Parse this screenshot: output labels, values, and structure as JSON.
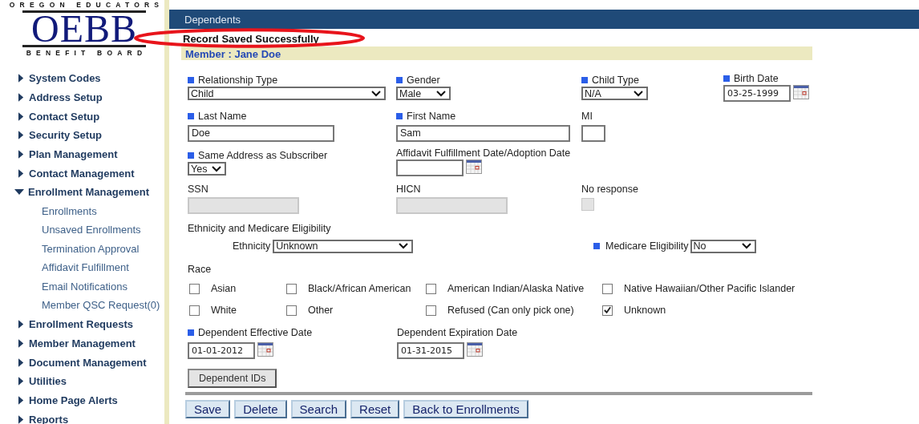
{
  "logo": {
    "top_line": "OREGON EDUCATORS",
    "name": "OEBB",
    "bottom_line": "BENEFIT BOARD"
  },
  "sidebar": {
    "items": [
      {
        "label": "System Codes",
        "expanded": false
      },
      {
        "label": "Address Setup",
        "expanded": false
      },
      {
        "label": "Contact Setup",
        "expanded": false
      },
      {
        "label": "Security Setup",
        "expanded": false
      },
      {
        "label": "Plan Management",
        "expanded": false
      },
      {
        "label": "Contact Management",
        "expanded": false
      },
      {
        "label": "Enrollment Management",
        "expanded": true,
        "children": [
          {
            "label": "Enrollments"
          },
          {
            "label": "Unsaved Enrollments"
          },
          {
            "label": "Termination Approval"
          },
          {
            "label": "Affidavit Fulfillment"
          },
          {
            "label": "Email Notifications"
          },
          {
            "label": "Member QSC Request(0)"
          }
        ]
      },
      {
        "label": "Enrollment Requests",
        "expanded": false
      },
      {
        "label": "Member Management",
        "expanded": false
      },
      {
        "label": "Document Management",
        "expanded": false
      },
      {
        "label": "Utilities",
        "expanded": false
      },
      {
        "label": "Home Page Alerts",
        "expanded": false
      },
      {
        "label": "Reports",
        "expanded": false
      }
    ]
  },
  "header": {
    "title": "Dependents",
    "message": "Record Saved Successfully",
    "member": "Member : Jane Doe"
  },
  "form": {
    "rows": [
      [
        {
          "label": "Relationship Type",
          "required": true,
          "kind": "select",
          "value": "Child"
        },
        {
          "label": "Gender",
          "required": true,
          "kind": "select",
          "value": "Male"
        },
        {
          "label": "Child Type",
          "required": true,
          "kind": "select",
          "value": "N/A"
        },
        {
          "label": "Birth Date",
          "required": true,
          "kind": "date",
          "value": "03-25-1999"
        }
      ],
      [
        {
          "label": "Last Name",
          "required": true,
          "kind": "text",
          "value": "Doe"
        },
        {
          "label": "First Name",
          "required": true,
          "kind": "text",
          "value": "Sam"
        },
        {
          "label": "MI",
          "required": false,
          "kind": "text"
        }
      ],
      [
        {
          "label": "Same Address as Subscriber",
          "required": true,
          "kind": "select",
          "value": "Yes"
        },
        {
          "label": "Affidavit Fulfillment Date/Adoption Date",
          "required": false,
          "kind": "date"
        }
      ],
      [
        {
          "label": "SSN",
          "required": false,
          "kind": "text",
          "disabled": true
        },
        {
          "label": "HICN",
          "required": false,
          "kind": "text",
          "disabled": true
        },
        {
          "label": "No response",
          "required": false,
          "kind": "checkbox",
          "checked": false,
          "disabled": true
        }
      ]
    ]
  },
  "ethnicity": {
    "title": "Ethnicity and Medicare Eligibility",
    "ethnicity": {
      "label": "Ethnicity",
      "value": "Unknown"
    },
    "medicare": {
      "label": "Medicare Eligibility",
      "required": true,
      "value": "No"
    }
  },
  "race": {
    "title": "Race",
    "options": [
      {
        "label": "Asian",
        "checked": false
      },
      {
        "label": "Black/African American",
        "checked": false
      },
      {
        "label": "American Indian/Alaska Native",
        "checked": false
      },
      {
        "label": "Native Hawaiian/Other Pacific Islander",
        "checked": false
      },
      {
        "label": "White",
        "checked": false
      },
      {
        "label": "Other",
        "checked": false
      },
      {
        "label": "Refused (Can only pick one)",
        "checked": false
      },
      {
        "label": "Unknown",
        "checked": true
      }
    ]
  },
  "dates": [
    {
      "label": "Dependent Effective Date",
      "required": true,
      "value": "01-01-2012"
    },
    {
      "label": "Dependent Expiration Date",
      "required": false,
      "value": "01-31-2015"
    }
  ],
  "ids_button": "Dependent IDs",
  "actions": [
    "Save",
    "Delete",
    "Search",
    "Reset",
    "Back to Enrollments"
  ]
}
